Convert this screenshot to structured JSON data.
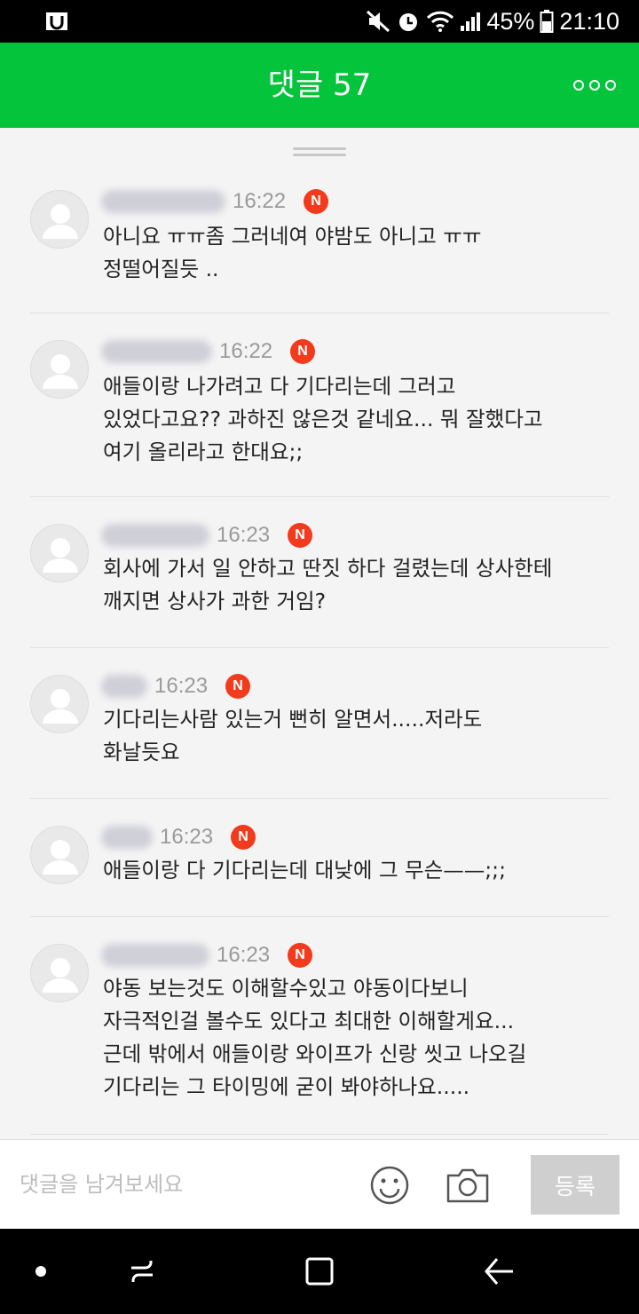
{
  "status_bar": {
    "battery": "45%",
    "time": "21:10",
    "icons": [
      "app-notification-icon",
      "mute-icon",
      "alarm-icon",
      "wifi-icon",
      "signal-icon",
      "battery-icon"
    ]
  },
  "header": {
    "title": "댓글 57",
    "more_icon": "more-icon",
    "background": "#03c43b"
  },
  "comments": [
    {
      "time": "16:22",
      "badge": "N",
      "text": "아니요 ㅠㅠ좀 그러네여 야밤도 아니고 ㅠㅠ\n정떨어질듯 .."
    },
    {
      "time": "16:22",
      "badge": "N",
      "text": "애들이랑 나가려고 다 기다리는데 그러고\n있었다고요?? 과하진 않은것 같네요... 뭐 잘했다고\n여기 올리라고 한대요;;"
    },
    {
      "time": "16:23",
      "badge": "N",
      "text": "회사에 가서 일 안하고 딴짓 하다 걸렸는데 상사한테\n깨지면 상사가 과한 거임?"
    },
    {
      "time": "16:23",
      "badge": "N",
      "text": "기다리는사람 있는거 뻔히 알면서.....저라도\n화날듯요"
    },
    {
      "time": "16:23",
      "badge": "N",
      "text": "애들이랑 다 기다리는데 대낮에 그 무슨——;;;"
    },
    {
      "time": "16:23",
      "badge": "N",
      "text": "야동 보는것도 이해할수있고 야동이다보니\n자극적인걸 볼수도 있다고 최대한 이해할게요...\n근데 밖에서 애들이랑 와이프가 신랑 씻고 나오길\n기다리는 그 타이밍에 굳이 봐야하나요....."
    }
  ],
  "input_bar": {
    "placeholder": "댓글을 남겨보세요",
    "emoji_icon": "emoji-icon",
    "camera_icon": "camera-icon",
    "submit_label": "등록"
  },
  "nav_bar": {
    "icons": [
      "home-dot-icon",
      "recent-apps-icon",
      "overview-icon",
      "back-icon"
    ]
  }
}
